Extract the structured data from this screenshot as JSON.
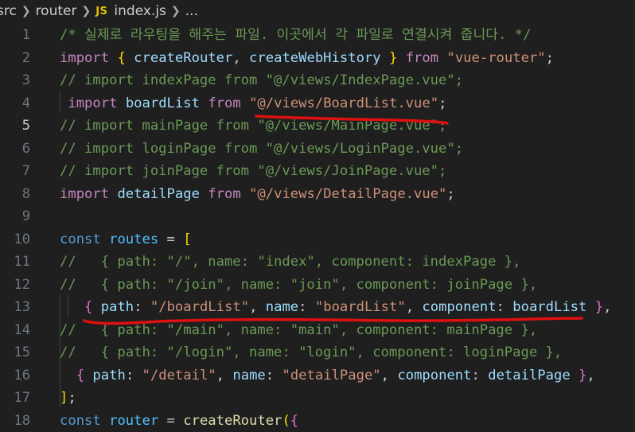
{
  "breadcrumb": {
    "segments": [
      "src",
      "router"
    ],
    "file_icon": "JS",
    "file_name": "index.js",
    "ellipsis": "..."
  },
  "editor": {
    "active_line": 5,
    "lines": [
      {
        "number": "1",
        "tokens": [
          {
            "t": "/* 실제로 라우팅을 해주는 파일. 이곳에서 각 파일로 연결시켜 줍니다. */",
            "c": "comment"
          }
        ]
      },
      {
        "number": "2",
        "tokens": [
          {
            "t": "import",
            "c": "kw"
          },
          {
            "t": " ",
            "c": "punc"
          },
          {
            "t": "{",
            "c": "brace"
          },
          {
            "t": " createRouter",
            "c": "var"
          },
          {
            "t": ", ",
            "c": "punc"
          },
          {
            "t": "createWebHistory",
            "c": "var"
          },
          {
            "t": " ",
            "c": "punc"
          },
          {
            "t": "}",
            "c": "brace"
          },
          {
            "t": " ",
            "c": "punc"
          },
          {
            "t": "from",
            "c": "kw"
          },
          {
            "t": " ",
            "c": "punc"
          },
          {
            "t": "\"vue-router\"",
            "c": "str"
          },
          {
            "t": ";",
            "c": "punc"
          }
        ]
      },
      {
        "number": "3",
        "tokens": [
          {
            "t": "// import indexPage from \"@/views/IndexPage.vue\";",
            "c": "comment"
          }
        ]
      },
      {
        "number": "4",
        "tokens": [
          {
            "t": " ",
            "c": "punc"
          },
          {
            "t": "import",
            "c": "kw"
          },
          {
            "t": " ",
            "c": "punc"
          },
          {
            "t": "boardList",
            "c": "var"
          },
          {
            "t": " ",
            "c": "punc"
          },
          {
            "t": "from",
            "c": "kw"
          },
          {
            "t": " ",
            "c": "punc"
          },
          {
            "t": "\"@/views/BoardList.vue\"",
            "c": "str"
          },
          {
            "t": ";",
            "c": "punc"
          }
        ]
      },
      {
        "number": "5",
        "tokens": [
          {
            "t": "// import mainPage from \"@/views/MainPage.vue\";",
            "c": "comment"
          }
        ]
      },
      {
        "number": "6",
        "tokens": [
          {
            "t": "// import loginPage from \"@/views/LoginPage.vue\";",
            "c": "comment"
          }
        ]
      },
      {
        "number": "7",
        "tokens": [
          {
            "t": "// import joinPage from \"@/views/JoinPage.vue\";",
            "c": "comment"
          }
        ]
      },
      {
        "number": "8",
        "tokens": [
          {
            "t": "import",
            "c": "kw"
          },
          {
            "t": " ",
            "c": "punc"
          },
          {
            "t": "detailPage",
            "c": "var"
          },
          {
            "t": " ",
            "c": "punc"
          },
          {
            "t": "from",
            "c": "kw"
          },
          {
            "t": " ",
            "c": "punc"
          },
          {
            "t": "\"@/views/DetailPage.vue\"",
            "c": "str"
          },
          {
            "t": ";",
            "c": "punc"
          }
        ]
      },
      {
        "number": "9",
        "tokens": []
      },
      {
        "number": "10",
        "tokens": [
          {
            "t": "const",
            "c": "sk"
          },
          {
            "t": " ",
            "c": "punc"
          },
          {
            "t": "routes",
            "c": "const"
          },
          {
            "t": " = ",
            "c": "punc"
          },
          {
            "t": "[",
            "c": "brace"
          }
        ]
      },
      {
        "number": "11",
        "tokens": [
          {
            "t": "//   { path: \"/\", name: \"index\", component: indexPage },",
            "c": "comment"
          }
        ]
      },
      {
        "number": "12",
        "tokens": [
          {
            "t": "//   { path: \"/join\", name: \"join\", component: joinPage },",
            "c": "comment"
          }
        ]
      },
      {
        "number": "13",
        "tokens": [
          {
            "t": "   ",
            "c": "punc"
          },
          {
            "t": "{",
            "c": "brace2"
          },
          {
            "t": " ",
            "c": "punc"
          },
          {
            "t": "path",
            "c": "var"
          },
          {
            "t": ": ",
            "c": "punc"
          },
          {
            "t": "\"/boardList\"",
            "c": "str"
          },
          {
            "t": ", ",
            "c": "punc"
          },
          {
            "t": "name",
            "c": "var"
          },
          {
            "t": ": ",
            "c": "punc"
          },
          {
            "t": "\"boardList\"",
            "c": "str"
          },
          {
            "t": ", ",
            "c": "punc"
          },
          {
            "t": "component",
            "c": "var"
          },
          {
            "t": ": ",
            "c": "punc"
          },
          {
            "t": "boardList",
            "c": "var"
          },
          {
            "t": " ",
            "c": "punc"
          },
          {
            "t": "}",
            "c": "brace2"
          },
          {
            "t": ",",
            "c": "punc"
          }
        ]
      },
      {
        "number": "14",
        "tokens": [
          {
            "t": "//   { path: \"/main\", name: \"main\", component: mainPage },",
            "c": "comment"
          }
        ]
      },
      {
        "number": "15",
        "tokens": [
          {
            "t": "//   { path: \"/login\", name: \"login\", component: loginPage },",
            "c": "comment"
          }
        ]
      },
      {
        "number": "16",
        "tokens": [
          {
            "t": "  ",
            "c": "punc"
          },
          {
            "t": "{",
            "c": "brace2"
          },
          {
            "t": " ",
            "c": "punc"
          },
          {
            "t": "path",
            "c": "var"
          },
          {
            "t": ": ",
            "c": "punc"
          },
          {
            "t": "\"/detail\"",
            "c": "str"
          },
          {
            "t": ", ",
            "c": "punc"
          },
          {
            "t": "name",
            "c": "var"
          },
          {
            "t": ": ",
            "c": "punc"
          },
          {
            "t": "\"detailPage\"",
            "c": "str"
          },
          {
            "t": ", ",
            "c": "punc"
          },
          {
            "t": "component",
            "c": "var"
          },
          {
            "t": ": ",
            "c": "punc"
          },
          {
            "t": "detailPage",
            "c": "var"
          },
          {
            "t": " ",
            "c": "punc"
          },
          {
            "t": "}",
            "c": "brace2"
          },
          {
            "t": ",",
            "c": "punc"
          }
        ]
      },
      {
        "number": "17",
        "tokens": [
          {
            "t": "]",
            "c": "brace"
          },
          {
            "t": ";",
            "c": "punc"
          }
        ]
      },
      {
        "number": "18",
        "tokens": [
          {
            "t": "const",
            "c": "sk"
          },
          {
            "t": " ",
            "c": "punc"
          },
          {
            "t": "router",
            "c": "const"
          },
          {
            "t": " = ",
            "c": "punc"
          },
          {
            "t": "createRouter",
            "c": "fn"
          },
          {
            "t": "(",
            "c": "brace"
          },
          {
            "t": "{",
            "c": "brace2"
          }
        ]
      }
    ]
  },
  "colors": {
    "background": "#1f1f1f",
    "annotation_red": "#e01010"
  }
}
